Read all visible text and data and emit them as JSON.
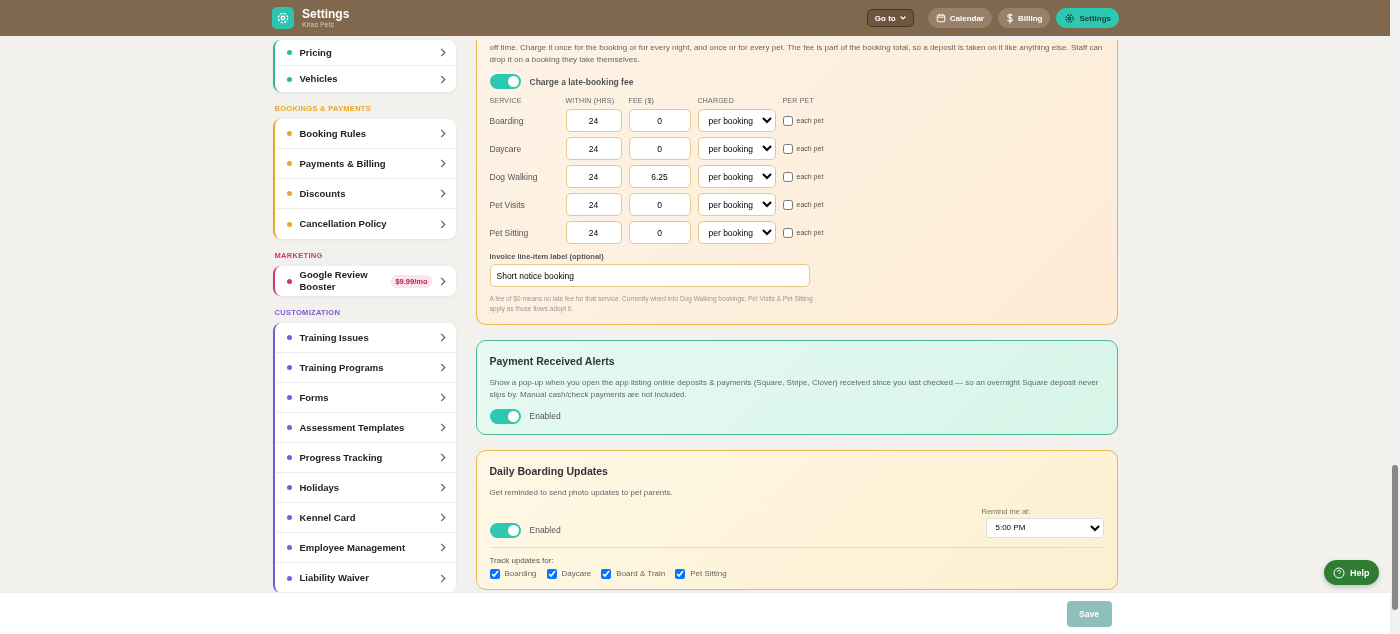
{
  "header": {
    "title": "Settings",
    "subtitle": "Kiras Pets",
    "goto": {
      "label": "Go to"
    },
    "nav": [
      {
        "label": "Calendar",
        "kind": "calendar",
        "selected": false
      },
      {
        "label": "Billing",
        "kind": "billing",
        "selected": false
      },
      {
        "label": "Settings",
        "kind": "settings",
        "selected": true
      }
    ]
  },
  "sidebar": {
    "groups": [
      {
        "color": "#2bb8a0",
        "items": [
          {
            "label": "Pricing"
          },
          {
            "label": "Vehicles"
          }
        ]
      },
      {
        "heading": "BOOKINGS & PAYMENTS",
        "color": "#e9a825",
        "items": [
          {
            "label": "Booking Rules"
          },
          {
            "label": "Payments & Billing"
          },
          {
            "label": "Discounts"
          },
          {
            "label": "Cancellation Policy"
          }
        ]
      },
      {
        "heading": "MARKETING",
        "color": "#d6336c",
        "items": [
          {
            "label": "Google Review Booster",
            "badge": "$9.99/mo"
          }
        ]
      },
      {
        "heading": "CUSTOMIZATION",
        "color": "#7b5cd6",
        "items": [
          {
            "label": "Training Issues"
          },
          {
            "label": "Training Programs"
          },
          {
            "label": "Forms"
          },
          {
            "label": "Assessment Templates"
          },
          {
            "label": "Progress Tracking"
          },
          {
            "label": "Holidays"
          },
          {
            "label": "Kennel Card"
          },
          {
            "label": "Employee Management"
          },
          {
            "label": "Liability Waiver"
          }
        ]
      }
    ]
  },
  "sections": [
    {
      "kind": "late_fee",
      "color": "#e8b94a",
      "description": "off time. Charge it once for the booking or for every night, and once or for every pet. The fee is part of the booking total, so a deposit is taken on it like anything else. Staff can drop it on a booking they take themselves.",
      "toggle": {
        "on": true,
        "label": "Charge a late-booking fee"
      },
      "columns": [
        "SERVICE",
        "WITHIN (HRS)",
        "FEE ($)",
        "CHARGED",
        "PER PET"
      ],
      "rows": [
        {
          "service": "Boarding",
          "within": "24",
          "fee": "0",
          "charged": "per booking",
          "per_pet": {
            "checked": false,
            "label": "each pet"
          }
        },
        {
          "service": "Daycare",
          "within": "24",
          "fee": "0",
          "charged": "per booking",
          "per_pet": {
            "checked": false,
            "label": "each pet"
          }
        },
        {
          "service": "Dog Walking",
          "within": "24",
          "fee": "6.25",
          "charged": "per booking",
          "per_pet": {
            "checked": false,
            "label": "each pet"
          }
        },
        {
          "service": "Pet Visits",
          "within": "24",
          "fee": "0",
          "charged": "per booking",
          "per_pet": {
            "checked": false,
            "label": "each pet"
          }
        },
        {
          "service": "Pet Sitting",
          "within": "24",
          "fee": "0",
          "charged": "per booking",
          "per_pet": {
            "checked": false,
            "label": "each pet"
          }
        }
      ],
      "label_field": {
        "label": "Invoice line-item label (optional)",
        "value": "Short notice booking"
      },
      "note": "A fee of $0 means no late fee for that service. Currently wired into Dog Walking bookings; Pet Visits & Pet Sitting apply as those flows adopt it."
    },
    {
      "kind": "alerts",
      "color": "#4cb89a",
      "title": "Payment Received Alerts",
      "description": "Show a pop-up when you open the app listing online deposits & payments (Square, Stripe, Clover) received since you last checked — so an overnight Square deposit never slips by. Manual cash/check payments are not included.",
      "toggle": {
        "on": true,
        "label": "Enabled"
      }
    },
    {
      "kind": "daily",
      "color": "#e8b94a",
      "title": "Daily Boarding Updates",
      "description": "Get reminded to send photo updates to pet parents.",
      "toggle": {
        "on": true,
        "label": "Enabled"
      },
      "remind": {
        "label": "Remind me at:",
        "value": "5:00 PM"
      },
      "track": {
        "label": "Track updates for:",
        "options": [
          {
            "label": "Boarding",
            "checked": true
          },
          {
            "label": "Daycare",
            "checked": true
          },
          {
            "label": "Board & Train",
            "checked": true
          },
          {
            "label": "Pet Sitting",
            "checked": true
          }
        ]
      }
    }
  ],
  "help": {
    "label": "Help"
  },
  "footer": {
    "save": "Save"
  }
}
